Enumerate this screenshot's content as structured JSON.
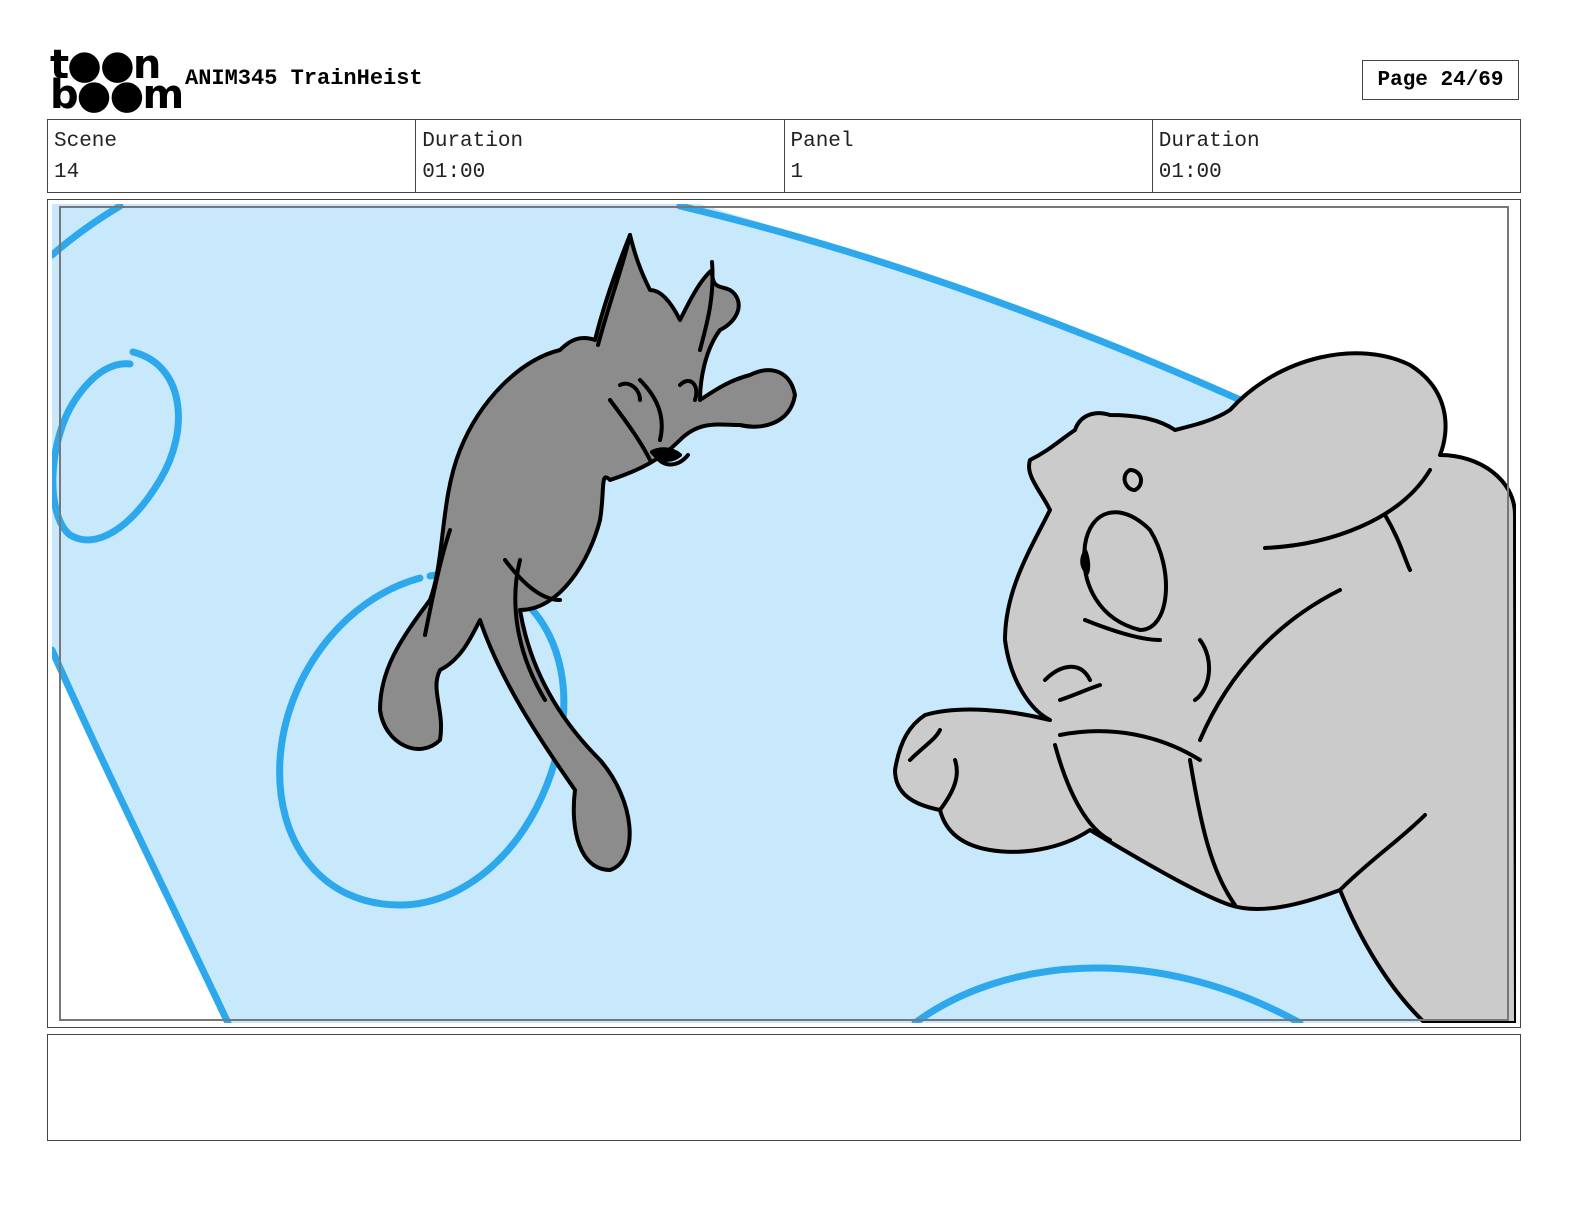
{
  "header": {
    "logo_line1": "t●●n",
    "logo_line2": "b●●m",
    "project_title": "ANIM345 TrainHeist",
    "page_label": "Page 24/69"
  },
  "info": [
    {
      "label": "Scene",
      "value": "14"
    },
    {
      "label": "Duration",
      "value": "01:00"
    },
    {
      "label": "Panel",
      "value": "1"
    },
    {
      "label": "Duration",
      "value": "01:00"
    }
  ],
  "notes": {
    "text": ""
  },
  "colors": {
    "sky": "#c8e9fb",
    "bubble": "#2ea8ec",
    "wolf": "#8c8c8c",
    "bear": "#cbcbcb",
    "line": "#000000"
  }
}
